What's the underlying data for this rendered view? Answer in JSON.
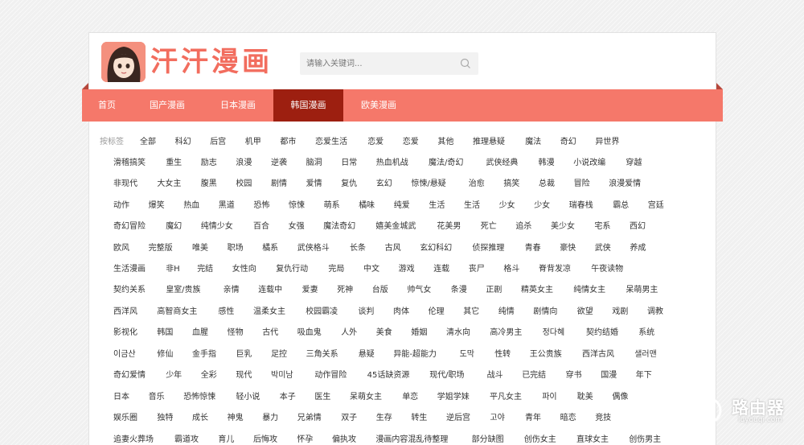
{
  "site": {
    "logo_text": "汗汗漫画"
  },
  "search": {
    "placeholder": "请输入关键词..."
  },
  "nav": {
    "items": [
      "首页",
      "国产漫画",
      "日本漫画",
      "韩国漫画",
      "欧美漫画"
    ],
    "active": "韩国漫画"
  },
  "tags": {
    "label": "按标签",
    "rows": [
      [
        "全部",
        "科幻",
        "后宫",
        "机甲",
        "都市",
        "恋爱生活",
        "恋爱",
        "恋爱",
        "其他",
        "推理悬疑",
        "魔法",
        "奇幻",
        "异世界"
      ],
      [
        "滑稽搞笑",
        "重生",
        "励志",
        "浪漫",
        "逆袭",
        "脑洞",
        "日常",
        "热血机战",
        "魔法/奇幻",
        "武侠经典",
        "韩漫",
        "小说改编",
        "穿越"
      ],
      [
        "非现代",
        "大女主",
        "腹黑",
        "校园",
        "剧情",
        "爱情",
        "复仇",
        "玄幻",
        "惊悚/悬疑",
        "治愈",
        "搞笑",
        "总裁",
        "冒险",
        "浪漫爱情"
      ],
      [
        "动作",
        "爆笑",
        "热血",
        "黑道",
        "恐怖",
        "惊悚",
        "萌系",
        "橘味",
        "纯爱",
        "生活",
        "生活",
        "少女",
        "少女",
        "瑞春栈",
        "霸总",
        "宫廷"
      ],
      [
        "奇幻冒险",
        "魔幻",
        "纯情少女",
        "百合",
        "女强",
        "魔法奇幻",
        "嬉美金城武",
        "花美男",
        "死亡",
        "追杀",
        "美少女",
        "宅系",
        "西幻"
      ],
      [
        "欧风",
        "完整版",
        "唯美",
        "职场",
        "橘系",
        "武侠格斗",
        "长条",
        "古风",
        "玄幻科幻",
        "侦探推理",
        "青春",
        "豪快",
        "武侠",
        "养成"
      ],
      [
        "生活漫画",
        "非H",
        "完结",
        "女性向",
        "复仇行动",
        "完局",
        "中文",
        "游戏",
        "连载",
        "丧尸",
        "格斗",
        "脊背发凉",
        "午夜读物"
      ],
      [
        "契约关系",
        "皇室/贵族",
        "亲情",
        "连载中",
        "爱妻",
        "死神",
        "台版",
        "帅气女",
        "条漫",
        "正剧",
        "精英女主",
        "纯情女主",
        "呆萌男主"
      ],
      [
        "西洋风",
        "高智商女主",
        "感性",
        "温柔女主",
        "校园霸凌",
        "谈判",
        "肉体",
        "伦理",
        "其它",
        "纯情",
        "剧情向",
        "欲望",
        "戏剧",
        "调教"
      ],
      [
        "影视化",
        "韩国",
        "血腥",
        "怪物",
        "古代",
        "吸血鬼",
        "人外",
        "美食",
        "婚姻",
        "清水向",
        "高冷男主",
        "정다혜",
        "契约结婚",
        "系统"
      ],
      [
        "이금산",
        "修仙",
        "金手指",
        "巨乳",
        "足控",
        "三角关系",
        "悬疑",
        "异能-超能力",
        "도막",
        "性转",
        "王公贵族",
        "西洋古风",
        "샐러맨"
      ],
      [
        "奇幻爱情",
        "少年",
        "全彩",
        "现代",
        "박미남",
        "动作冒险",
        "45话缺资源",
        "现代/职场",
        "战斗",
        "已完结",
        "穿书",
        "国漫",
        "年下"
      ],
      [
        "日本",
        "音乐",
        "恐怖惊悚",
        "轻小说",
        "本子",
        "医生",
        "呆萌女主",
        "单恋",
        "学姐学妹",
        "平凡女主",
        "파이",
        "耽美",
        "偶像"
      ],
      [
        "娱乐圈",
        "独特",
        "成长",
        "神鬼",
        "暴力",
        "兄弟情",
        "双子",
        "生存",
        "转生",
        "逆后宫",
        "고야",
        "青年",
        "暗恋",
        "竞技"
      ],
      [
        "追妻火葬场",
        "霸道攻",
        "育儿",
        "后悔攻",
        "怀孕",
        "偏执攻",
        "漫画内容混乱待整理",
        "部分缺图",
        "创伤女主",
        "直球女主",
        "创伤男主"
      ]
    ]
  },
  "watermark": {
    "title": "路由器",
    "subtitle": "luyouqi.com"
  }
}
